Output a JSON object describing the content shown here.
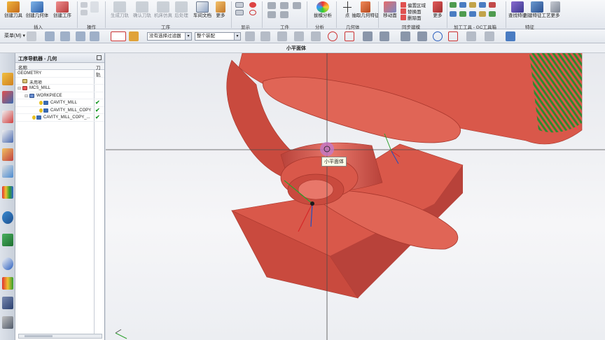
{
  "ribbon": {
    "insert": {
      "create_tool": "创建刀具",
      "create_geometry": "创建几何体",
      "create_operation": "创建工序",
      "group_label": "插入"
    },
    "operations": {
      "group_label": "操作"
    },
    "ops_workbench": {
      "gen_path": "生成刀轨",
      "confirm_path": "确认刀轨",
      "machine_sim": "机床仿真",
      "post_process": "后处理",
      "shop_doc": "车间文档",
      "more": "更多",
      "group_label": "工序"
    },
    "display": {
      "group_label": "显示"
    },
    "workpiece": {
      "group_label": "工件"
    },
    "analysis": {
      "slope_analysis": "拔模分析",
      "group_label": "分析"
    },
    "geometry": {
      "point": "点",
      "extract_geometry": "抽取几何特征",
      "group_label": "几何体"
    },
    "sync": {
      "move_face": "移动面",
      "offset_region": "偏置区域",
      "replace_face": "替换面",
      "delete_face": "删除面",
      "more": "更多",
      "group_label": "同步建模"
    },
    "machining_tools": {
      "group_label": "加工工具 - GC工具箱"
    },
    "features": {
      "find_feature": "查找特征",
      "create_feature_process": "创建特征工艺",
      "more": "更多",
      "group_label": "特征"
    }
  },
  "toolbar": {
    "menu": "菜单(M) ▾",
    "filter_select": "没有选择过滤器",
    "assembly_select": "整个装配"
  },
  "window_title": "小平面体",
  "navigator": {
    "title": "工序导航器 - 几何",
    "col_name": "名称",
    "col_tool": "刀轨",
    "rows": [
      {
        "label": "GEOMETRY",
        "check": ""
      },
      {
        "label": "未用项",
        "check": ""
      },
      {
        "label": "MCS_MILL",
        "check": ""
      },
      {
        "label": "WORKPIECE",
        "check": ""
      },
      {
        "label": "CAVITY_MILL",
        "check": "✔"
      },
      {
        "label": "CAVITY_MILL_COPY",
        "check": "✔"
      },
      {
        "label": "CAVITY_MILL_COPY_...",
        "check": "✔"
      }
    ]
  },
  "graphics": {
    "tooltip": "小平面体"
  },
  "colors": {
    "model": "#d9584a",
    "model_dark": "#a8372d",
    "model_light": "#e8776a",
    "stripe": "#2f8a2f",
    "crosshair": "#4a4a4a"
  }
}
